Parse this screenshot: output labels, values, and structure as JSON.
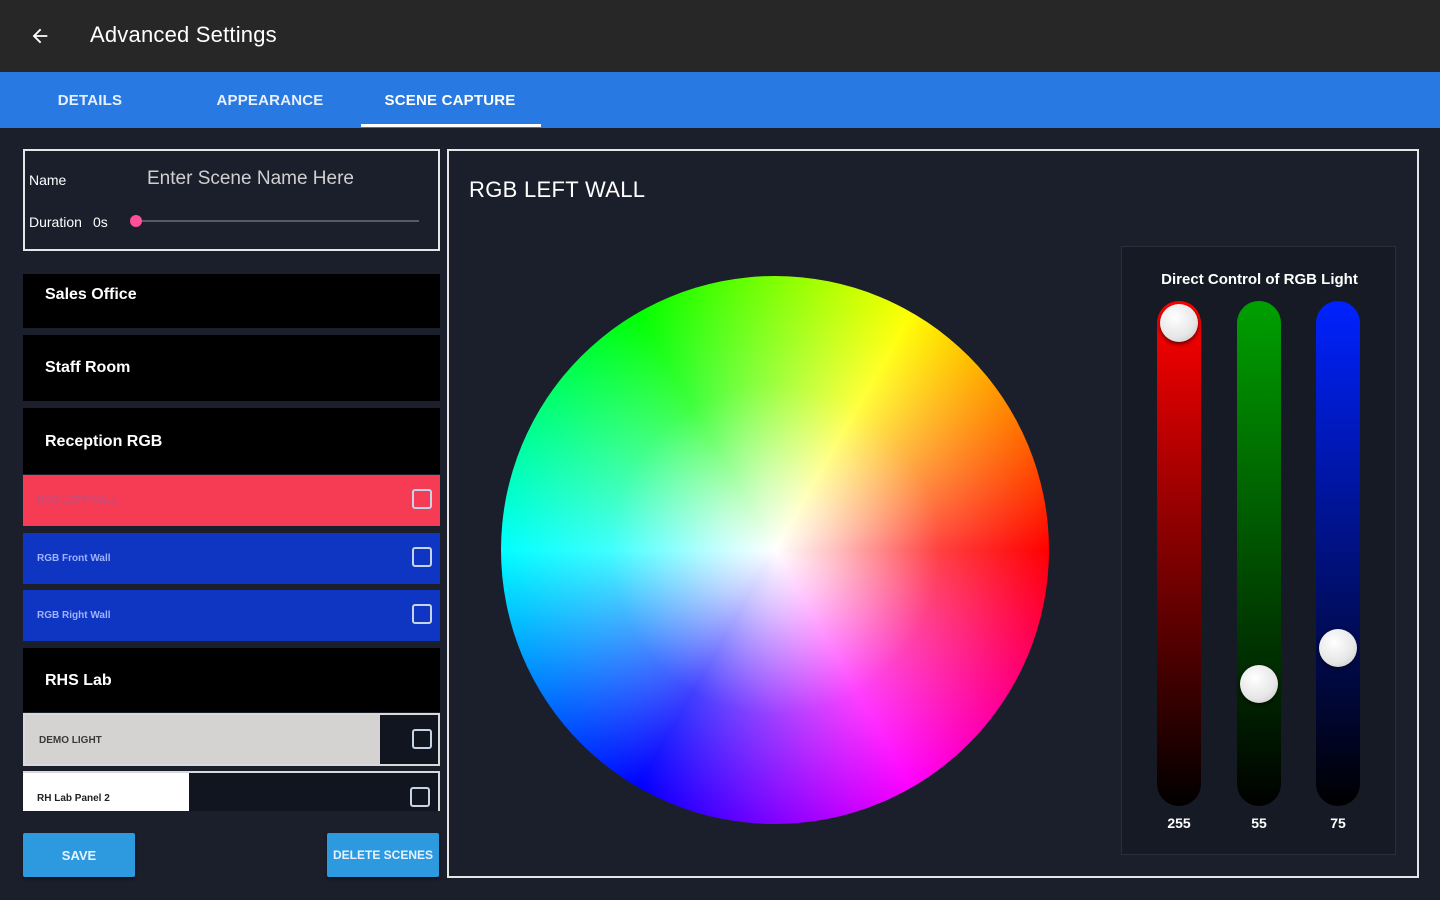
{
  "header": {
    "back_icon": "arrow-left-icon",
    "title": "Advanced Settings"
  },
  "tabs": [
    {
      "label": "DETAILS"
    },
    {
      "label": "APPEARANCE"
    },
    {
      "label": "SCENE CAPTURE",
      "active": true
    }
  ],
  "scene_form": {
    "name_label": "Name",
    "name_placeholder": "Enter Scene Name Here",
    "duration_label": "Duration",
    "duration_value": "0s",
    "duration_fraction": 0
  },
  "groups": [
    {
      "label": "Sales Office"
    },
    {
      "label": "Staff Room"
    },
    {
      "label": "Reception RGB"
    }
  ],
  "lights": [
    {
      "label": "RGB LEFT WALL",
      "color": "#f63b54",
      "text_color": "#c84a77"
    },
    {
      "label": "RGB Front Wall",
      "color": "#0f36c2",
      "text_color": "#9fb3ff"
    },
    {
      "label": "RGB Right Wall",
      "color": "#0f36c2",
      "text_color": "#9fb3ff"
    }
  ],
  "group_rhs": {
    "label": "RHS Lab"
  },
  "dim_lights": [
    {
      "label": "DEMO LIGHT",
      "level": 0.86,
      "fill_color": "#d5d3d1",
      "text_color": "#3a3a3a"
    },
    {
      "label": "RH Lab Panel 2",
      "level": 0.4,
      "fill_color": "#ffffff",
      "text_color": "#222222"
    }
  ],
  "buttons": {
    "save": "SAVE",
    "delete": "DELETE SCENES"
  },
  "light_panel": {
    "title": "RGB LEFT WALL",
    "direct_title": "Direct Control of RGB Light",
    "channels": [
      {
        "name": "red",
        "value": "255",
        "level": 1.0,
        "color": "#ff0000"
      },
      {
        "name": "green",
        "value": "55",
        "level": 0.216,
        "color": "#00a000"
      },
      {
        "name": "blue",
        "value": "75",
        "level": 0.294,
        "color": "#0022ff"
      }
    ]
  }
}
